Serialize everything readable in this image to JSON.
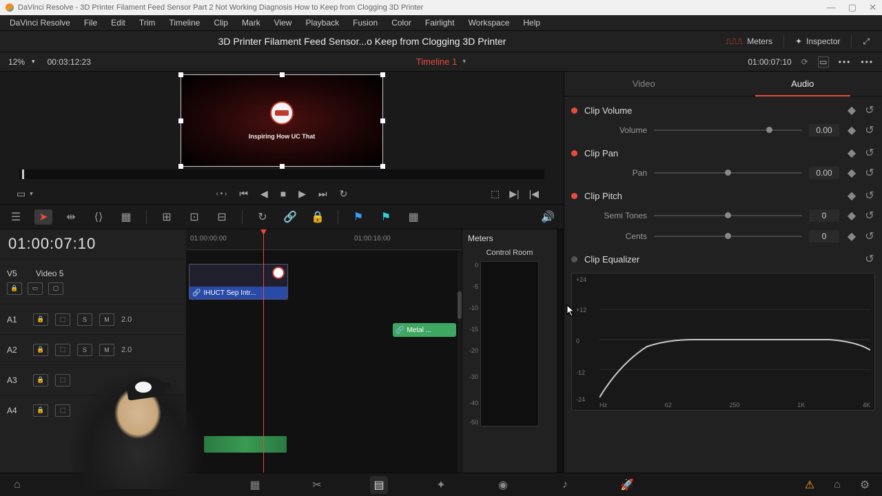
{
  "window": {
    "title": "DaVinci Resolve - 3D Printer Filament Feed Sensor Part 2 Not Working Diagnosis How to Keep from Clogging 3D Printer"
  },
  "menubar": [
    "DaVinci Resolve",
    "File",
    "Edit",
    "Trim",
    "Timeline",
    "Clip",
    "Mark",
    "View",
    "Playback",
    "Fusion",
    "Color",
    "Fairlight",
    "Workspace",
    "Help"
  ],
  "toolbar": {
    "project_title": "3D Printer Filament Feed Sensor...o Keep from Clogging 3D Printer",
    "meters": "Meters",
    "inspector": "Inspector"
  },
  "statusbar": {
    "zoom": "12%",
    "duration": "00:03:12:23",
    "timeline_name": "Timeline 1",
    "viewer_timecode": "01:00:07:10"
  },
  "viewer": {
    "subtitle": "Inspiring How UC That"
  },
  "timeline": {
    "timecode": "01:00:07:10",
    "ruler": {
      "start": "01:00:00:00",
      "mid": "01:00:16:00"
    },
    "tracks": {
      "video": {
        "id": "V5",
        "name": "Video 5"
      },
      "a1": {
        "id": "A1",
        "ch": "2.0"
      },
      "a2": {
        "id": "A2",
        "ch": "2.0"
      },
      "a3": {
        "id": "A3"
      },
      "a4": {
        "id": "A4"
      }
    },
    "clips": {
      "video": "IHUCT Sep Intr...",
      "audio": "Metal ..."
    }
  },
  "meters": {
    "title": "Meters",
    "control_room": "Control Room",
    "scale": [
      "0",
      "-5",
      "-10",
      "-15",
      "-20",
      "-30",
      "-40",
      "-50"
    ]
  },
  "inspector": {
    "tabs": {
      "video": "Video",
      "audio": "Audio"
    },
    "sections": {
      "volume": {
        "title": "Clip Volume",
        "label": "Volume",
        "value": "0.00"
      },
      "pan": {
        "title": "Clip Pan",
        "label": "Pan",
        "value": "0.00"
      },
      "pitch": {
        "title": "Clip Pitch",
        "semi_label": "Semi Tones",
        "semi_value": "0",
        "cents_label": "Cents",
        "cents_value": "0"
      },
      "eq": {
        "title": "Clip Equalizer",
        "ylabels": [
          "+24",
          "+12",
          "0",
          "-12",
          "-24"
        ],
        "xlabels": [
          "Hz",
          "62",
          "250",
          "1K",
          "4K"
        ]
      }
    }
  },
  "track_buttons": {
    "s": "S",
    "m": "M"
  }
}
